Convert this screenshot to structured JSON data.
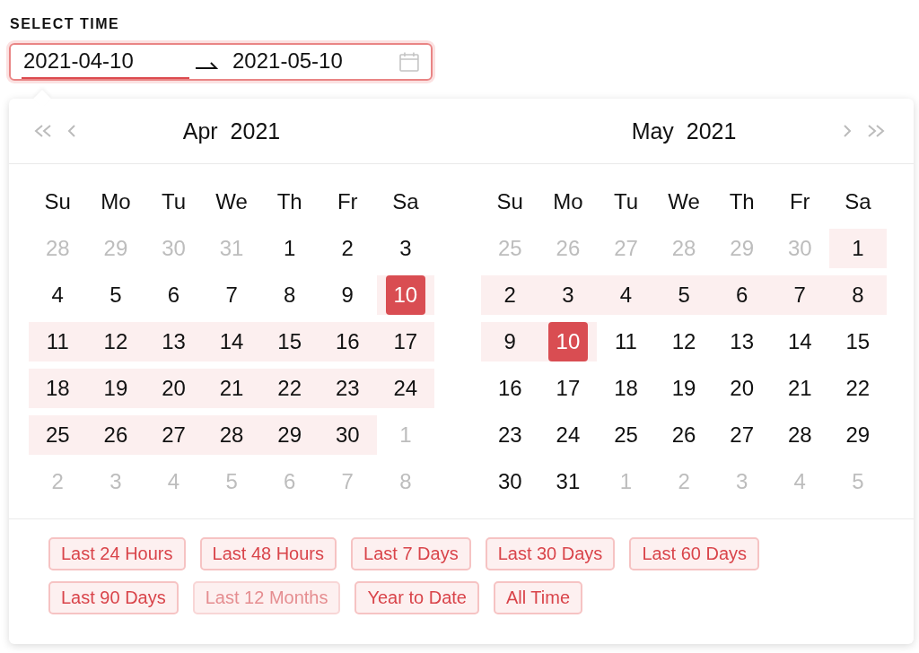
{
  "label": "SELECT TIME",
  "range_input": {
    "start": {
      "value": "2021-04-10",
      "active": true
    },
    "end": {
      "value": "2021-05-10",
      "active": false
    }
  },
  "calendars": [
    {
      "month": "Apr",
      "year": "2021",
      "weekdays": [
        "Su",
        "Mo",
        "Tu",
        "We",
        "Th",
        "Fr",
        "Sa"
      ],
      "days": [
        {
          "day": "28",
          "muted": true,
          "in_range": false,
          "selected": false
        },
        {
          "day": "29",
          "muted": true,
          "in_range": false,
          "selected": false
        },
        {
          "day": "30",
          "muted": true,
          "in_range": false,
          "selected": false
        },
        {
          "day": "31",
          "muted": true,
          "in_range": false,
          "selected": false
        },
        {
          "day": "1",
          "muted": false,
          "in_range": false,
          "selected": false
        },
        {
          "day": "2",
          "muted": false,
          "in_range": false,
          "selected": false
        },
        {
          "day": "3",
          "muted": false,
          "in_range": false,
          "selected": false
        },
        {
          "day": "4",
          "muted": false,
          "in_range": false,
          "selected": false
        },
        {
          "day": "5",
          "muted": false,
          "in_range": false,
          "selected": false
        },
        {
          "day": "6",
          "muted": false,
          "in_range": false,
          "selected": false
        },
        {
          "day": "7",
          "muted": false,
          "in_range": false,
          "selected": false
        },
        {
          "day": "8",
          "muted": false,
          "in_range": false,
          "selected": false
        },
        {
          "day": "9",
          "muted": false,
          "in_range": false,
          "selected": false
        },
        {
          "day": "10",
          "muted": false,
          "in_range": true,
          "selected": true
        },
        {
          "day": "11",
          "muted": false,
          "in_range": true,
          "selected": false
        },
        {
          "day": "12",
          "muted": false,
          "in_range": true,
          "selected": false
        },
        {
          "day": "13",
          "muted": false,
          "in_range": true,
          "selected": false
        },
        {
          "day": "14",
          "muted": false,
          "in_range": true,
          "selected": false
        },
        {
          "day": "15",
          "muted": false,
          "in_range": true,
          "selected": false
        },
        {
          "day": "16",
          "muted": false,
          "in_range": true,
          "selected": false
        },
        {
          "day": "17",
          "muted": false,
          "in_range": true,
          "selected": false
        },
        {
          "day": "18",
          "muted": false,
          "in_range": true,
          "selected": false
        },
        {
          "day": "19",
          "muted": false,
          "in_range": true,
          "selected": false
        },
        {
          "day": "20",
          "muted": false,
          "in_range": true,
          "selected": false
        },
        {
          "day": "21",
          "muted": false,
          "in_range": true,
          "selected": false
        },
        {
          "day": "22",
          "muted": false,
          "in_range": true,
          "selected": false
        },
        {
          "day": "23",
          "muted": false,
          "in_range": true,
          "selected": false
        },
        {
          "day": "24",
          "muted": false,
          "in_range": true,
          "selected": false
        },
        {
          "day": "25",
          "muted": false,
          "in_range": true,
          "selected": false
        },
        {
          "day": "26",
          "muted": false,
          "in_range": true,
          "selected": false
        },
        {
          "day": "27",
          "muted": false,
          "in_range": true,
          "selected": false
        },
        {
          "day": "28",
          "muted": false,
          "in_range": true,
          "selected": false
        },
        {
          "day": "29",
          "muted": false,
          "in_range": true,
          "selected": false
        },
        {
          "day": "30",
          "muted": false,
          "in_range": true,
          "selected": false
        },
        {
          "day": "1",
          "muted": true,
          "in_range": false,
          "selected": false
        },
        {
          "day": "2",
          "muted": true,
          "in_range": false,
          "selected": false
        },
        {
          "day": "3",
          "muted": true,
          "in_range": false,
          "selected": false
        },
        {
          "day": "4",
          "muted": true,
          "in_range": false,
          "selected": false
        },
        {
          "day": "5",
          "muted": true,
          "in_range": false,
          "selected": false
        },
        {
          "day": "6",
          "muted": true,
          "in_range": false,
          "selected": false
        },
        {
          "day": "7",
          "muted": true,
          "in_range": false,
          "selected": false
        },
        {
          "day": "8",
          "muted": true,
          "in_range": false,
          "selected": false
        }
      ]
    },
    {
      "month": "May",
      "year": "2021",
      "weekdays": [
        "Su",
        "Mo",
        "Tu",
        "We",
        "Th",
        "Fr",
        "Sa"
      ],
      "days": [
        {
          "day": "25",
          "muted": true,
          "in_range": false,
          "selected": false
        },
        {
          "day": "26",
          "muted": true,
          "in_range": false,
          "selected": false
        },
        {
          "day": "27",
          "muted": true,
          "in_range": false,
          "selected": false
        },
        {
          "day": "28",
          "muted": true,
          "in_range": false,
          "selected": false
        },
        {
          "day": "29",
          "muted": true,
          "in_range": false,
          "selected": false
        },
        {
          "day": "30",
          "muted": true,
          "in_range": false,
          "selected": false
        },
        {
          "day": "1",
          "muted": false,
          "in_range": true,
          "selected": false
        },
        {
          "day": "2",
          "muted": false,
          "in_range": true,
          "selected": false
        },
        {
          "day": "3",
          "muted": false,
          "in_range": true,
          "selected": false
        },
        {
          "day": "4",
          "muted": false,
          "in_range": true,
          "selected": false
        },
        {
          "day": "5",
          "muted": false,
          "in_range": true,
          "selected": false
        },
        {
          "day": "6",
          "muted": false,
          "in_range": true,
          "selected": false
        },
        {
          "day": "7",
          "muted": false,
          "in_range": true,
          "selected": false
        },
        {
          "day": "8",
          "muted": false,
          "in_range": true,
          "selected": false
        },
        {
          "day": "9",
          "muted": false,
          "in_range": true,
          "selected": false
        },
        {
          "day": "10",
          "muted": false,
          "in_range": true,
          "selected": true
        },
        {
          "day": "11",
          "muted": false,
          "in_range": false,
          "selected": false
        },
        {
          "day": "12",
          "muted": false,
          "in_range": false,
          "selected": false
        },
        {
          "day": "13",
          "muted": false,
          "in_range": false,
          "selected": false
        },
        {
          "day": "14",
          "muted": false,
          "in_range": false,
          "selected": false
        },
        {
          "day": "15",
          "muted": false,
          "in_range": false,
          "selected": false
        },
        {
          "day": "16",
          "muted": false,
          "in_range": false,
          "selected": false
        },
        {
          "day": "17",
          "muted": false,
          "in_range": false,
          "selected": false
        },
        {
          "day": "18",
          "muted": false,
          "in_range": false,
          "selected": false
        },
        {
          "day": "19",
          "muted": false,
          "in_range": false,
          "selected": false
        },
        {
          "day": "20",
          "muted": false,
          "in_range": false,
          "selected": false
        },
        {
          "day": "21",
          "muted": false,
          "in_range": false,
          "selected": false
        },
        {
          "day": "22",
          "muted": false,
          "in_range": false,
          "selected": false
        },
        {
          "day": "23",
          "muted": false,
          "in_range": false,
          "selected": false
        },
        {
          "day": "24",
          "muted": false,
          "in_range": false,
          "selected": false
        },
        {
          "day": "25",
          "muted": false,
          "in_range": false,
          "selected": false
        },
        {
          "day": "26",
          "muted": false,
          "in_range": false,
          "selected": false
        },
        {
          "day": "27",
          "muted": false,
          "in_range": false,
          "selected": false
        },
        {
          "day": "28",
          "muted": false,
          "in_range": false,
          "selected": false
        },
        {
          "day": "29",
          "muted": false,
          "in_range": false,
          "selected": false
        },
        {
          "day": "30",
          "muted": false,
          "in_range": false,
          "selected": false
        },
        {
          "day": "31",
          "muted": false,
          "in_range": false,
          "selected": false
        },
        {
          "day": "1",
          "muted": true,
          "in_range": false,
          "selected": false
        },
        {
          "day": "2",
          "muted": true,
          "in_range": false,
          "selected": false
        },
        {
          "day": "3",
          "muted": true,
          "in_range": false,
          "selected": false
        },
        {
          "day": "4",
          "muted": true,
          "in_range": false,
          "selected": false
        },
        {
          "day": "5",
          "muted": true,
          "in_range": false,
          "selected": false
        }
      ]
    }
  ],
  "presets": [
    {
      "label": "Last 24 Hours",
      "disabled": false
    },
    {
      "label": "Last 48 Hours",
      "disabled": false
    },
    {
      "label": "Last 7 Days",
      "disabled": false
    },
    {
      "label": "Last 30 Days",
      "disabled": false
    },
    {
      "label": "Last 60 Days",
      "disabled": false
    },
    {
      "label": "Last 90 Days",
      "disabled": false
    },
    {
      "label": "Last 12 Months",
      "disabled": true
    },
    {
      "label": "Year to Date",
      "disabled": false
    },
    {
      "label": "All Time",
      "disabled": false
    }
  ]
}
